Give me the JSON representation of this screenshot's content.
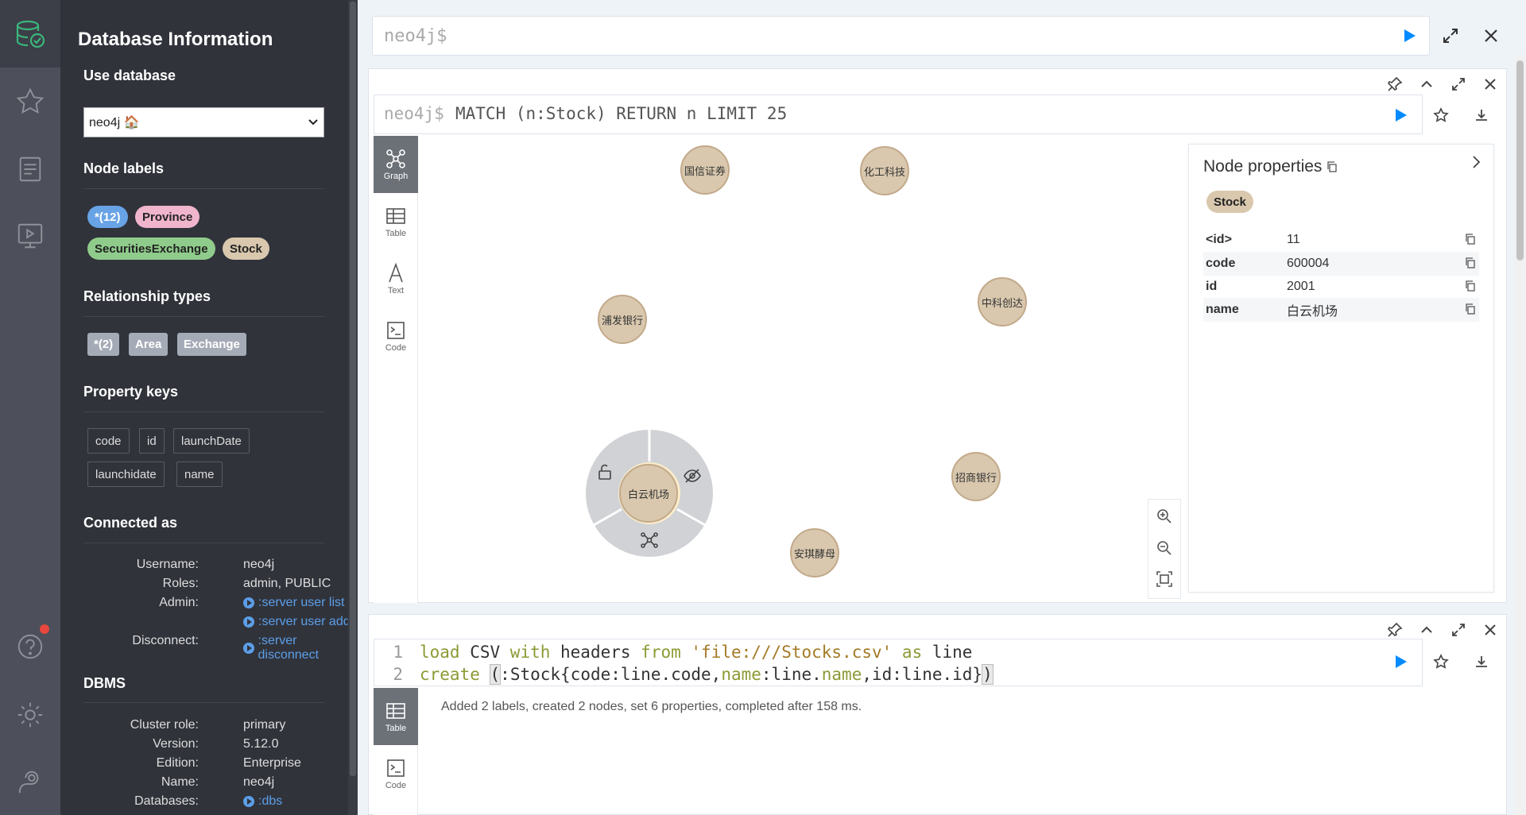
{
  "drawer": {
    "title": "Database Information",
    "use_database": {
      "title": "Use database",
      "selected": "neo4j 🏠"
    },
    "node_labels": {
      "title": "Node labels",
      "items": [
        {
          "label": "*(12)",
          "color": "#68a3e6"
        },
        {
          "label": "Province",
          "color": "#f0b5cc"
        },
        {
          "label": "SecuritiesExchange",
          "color": "#8fcc8b"
        },
        {
          "label": "Stock",
          "color": "#d9c8ae"
        }
      ]
    },
    "relationship_types": {
      "title": "Relationship types",
      "items": [
        "*(2)",
        "Area",
        "Exchange"
      ]
    },
    "property_keys": {
      "title": "Property keys",
      "items": [
        "code",
        "id",
        "launchDate",
        "launchidate",
        "name"
      ]
    },
    "connected_as": {
      "title": "Connected as",
      "username_label": "Username:",
      "username": "neo4j",
      "roles_label": "Roles:",
      "roles": "admin, PUBLIC",
      "admin_label": "Admin:",
      "admin_link1": ":server user list",
      "admin_link2": ":server user add",
      "disconnect_label": "Disconnect:",
      "disconnect_link": ":server disconnect"
    },
    "dbms": {
      "title": "DBMS",
      "cluster_role_label": "Cluster role:",
      "cluster_role": "primary",
      "version_label": "Version:",
      "version": "5.12.0",
      "edition_label": "Edition:",
      "edition": "Enterprise",
      "name_label": "Name:",
      "name": "neo4j",
      "databases_label": "Databases:",
      "databases_link": ":dbs"
    }
  },
  "top_editor": {
    "prompt": "neo4j$"
  },
  "frame1": {
    "prompt": "neo4j$",
    "query": "MATCH (n:Stock) RETURN n LIMIT 25",
    "tabs": [
      "Graph",
      "Table",
      "Text",
      "Code"
    ],
    "nodes": [
      "国信证券",
      "化工科技",
      "浦发银行",
      "中科创达",
      "白云机场",
      "招商银行",
      "安琪酵母"
    ],
    "properties": {
      "title": "Node properties",
      "label": "Stock",
      "rows": [
        {
          "key": "<id>",
          "value": "11"
        },
        {
          "key": "code",
          "value": "600004"
        },
        {
          "key": "id",
          "value": "2001"
        },
        {
          "key": "name",
          "value": "白云机场"
        }
      ]
    }
  },
  "frame2": {
    "line_numbers": [
      "1",
      "2"
    ],
    "line1": {
      "load": "load",
      "csv": " CSV ",
      "with": "with",
      "headers": " headers ",
      "from": "from",
      "sp": " ",
      "str": "'file:///Stocks.csv'",
      "as": " as ",
      "line": "line"
    },
    "line2": {
      "create": "create",
      "sp": " ",
      "open": "(",
      "body_a": ":Stock{code:line.code,",
      "name1": "name",
      "body_b": ":line.",
      "name2": "name",
      "body_c": ",id:line.id}",
      "close": ")"
    },
    "tabs": [
      "Table",
      "Code"
    ],
    "result": "Added 2 labels, created 2 nodes, set 6 properties, completed after 158 ms."
  },
  "colors": {
    "accent": "#018bff",
    "rail": "#4d4f5a",
    "drawer": "#31333b",
    "stock_node": "#d9c8ae",
    "keyword": "#8d9a34",
    "string": "#a37a25"
  }
}
